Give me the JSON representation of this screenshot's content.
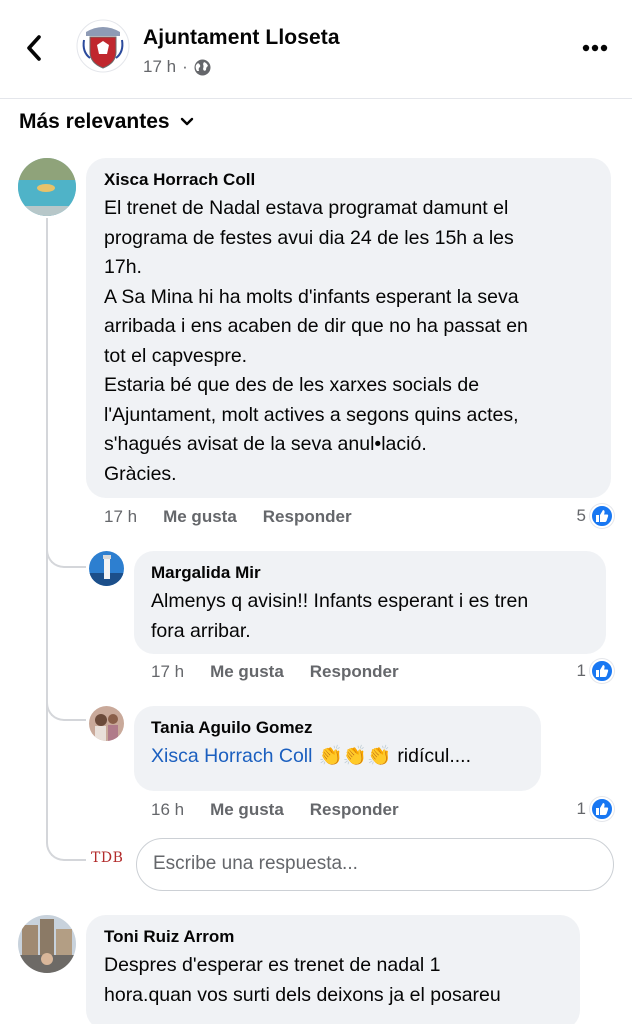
{
  "header": {
    "page_name": "Ajuntament Lloseta",
    "post_time": "17 h",
    "back_icon": "chevron-left-icon",
    "more_icon": "more-dots-icon",
    "globe_icon": "globe-icon"
  },
  "sort": {
    "label": "Más relevantes",
    "icon": "chevron-down-icon"
  },
  "comments": [
    {
      "author": "Xisca Horrach Coll",
      "lines": [
        "El trenet de Nadal estava programat damunt el",
        "programa de festes avui dia 24 de les 15h a les",
        "17h.",
        "A Sa Mina hi ha molts d'infants esperant la seva",
        "arribada i ens acaben de dir que no ha passat en",
        "tot el capvespre.",
        "Estaria bé que des de les xarxes socials de",
        "l'Ajuntament, molt actives a segons quins actes,",
        "s'hagués avisat de la seva anul•lació.",
        "Gràcies."
      ],
      "time": "17 h",
      "like_label": "Me gusta",
      "reply_label": "Responder",
      "reaction_count": "5",
      "replies": [
        {
          "author": "Margalida Mir",
          "lines": [
            "Almenys q avisin!! Infants esperant i es tren",
            "fora arribar."
          ],
          "time": "17 h",
          "like_label": "Me gusta",
          "reply_label": "Responder",
          "reaction_count": "1"
        },
        {
          "author": "Tania Aguilo Gomez",
          "mention": "Xisca Horrach Coll",
          "emoji": "👏👏👏",
          "text": "ridícul....",
          "time": "16 h",
          "like_label": "Me gusta",
          "reply_label": "Responder",
          "reaction_count": "1"
        }
      ],
      "reply_box": {
        "avatar_text": "TDB",
        "placeholder": "Escribe una respuesta..."
      }
    },
    {
      "author": "Toni Ruiz Arrom",
      "lines": [
        "Despres d'esperar es trenet de nadal 1",
        "hora.quan vos surti dels deixons ja el posareu"
      ]
    }
  ],
  "colors": {
    "like_blue": "#1877f2",
    "bubble_bg": "#f0f2f5",
    "mention": "#1b5fbf",
    "meta_gray": "#65676b"
  }
}
